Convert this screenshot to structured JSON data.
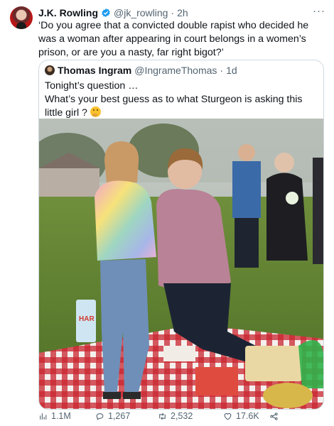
{
  "tweet": {
    "author_name": "J.K. Rowling",
    "handle": "@jk_rowling",
    "separator": "·",
    "time": "2h",
    "more_label": "···",
    "text": "‘Do you agree that a convicted double rapist who decided he was a woman after appearing in court belongs in a women’s prison, or are you a nasty, far right bigot?’"
  },
  "quote": {
    "author_name": "Thomas Ingram",
    "handle": "@IngrameThomas",
    "separator": "·",
    "time": "1d",
    "text_line1": "Tonight’s question …",
    "text_line2": "What’s your best guess as to what Sturgeon is asking this little girl ?",
    "photo_sign_text": "HAR"
  },
  "actions": {
    "views": "1.1M",
    "replies": "1,267",
    "retweets": "2,532",
    "likes": "17.6K"
  },
  "icons": {
    "verified": "verified-badge-icon",
    "views": "bar-chart-icon",
    "reply": "speech-bubble-icon",
    "retweet": "retweet-icon",
    "like": "heart-icon",
    "share": "share-icon"
  },
  "colors": {
    "text": "#0f1419",
    "muted": "#536471",
    "verified": "#1d9bf0",
    "border": "#cfd9de"
  }
}
